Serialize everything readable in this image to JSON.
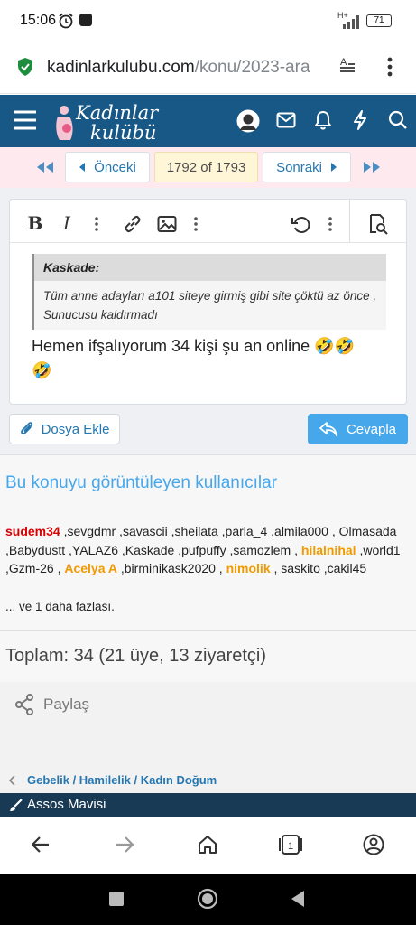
{
  "status": {
    "time": "15:06",
    "network": "H+",
    "battery": "71"
  },
  "browser": {
    "url_domain": "kadinlarkulubu.com",
    "url_path": "/konu/2023-ara"
  },
  "site": {
    "logo_line1": "Kadınlar",
    "logo_line2": "kulübü"
  },
  "pagination": {
    "prev_label": "Önceki",
    "page_info": "1792 of 1793",
    "next_label": "Sonraki"
  },
  "quote": {
    "author": "Kaskade:",
    "text": "Tüm anne adayları a101 siteye girmiş gibi site çöktü az önce , Sunucusu kaldırmadı"
  },
  "reply": {
    "line1": "Hemen ifşalıyorum 34 kişi şu an online 🤣🤣",
    "line2": "🤣"
  },
  "buttons": {
    "attach_label": "Dosya Ekle",
    "reply_label": "Cevapla"
  },
  "viewers": {
    "title": "Bu konuyu görüntüleyen kullanıcılar",
    "u1": "sudem34",
    "t1": " ,sevgdmr ,savascii ,sheilata ,parla_4 ,almila000 , Olmasada ,Babydustt ,YALAZ6 ,Kaskade ,pufpuffy ,samozlem , ",
    "u2": "hilalnihal",
    "t2": " ,world1 ,Gzm-26 , ",
    "u3": "Acelya A",
    "t3": " ,birminikask2020 , ",
    "u4": "nimolik",
    "t4": " , saskito ,cakil45",
    "more": "... ve 1 daha fazlası."
  },
  "totals": {
    "text": "Toplam: 34 (21 üye, 13 ziyaretçi)"
  },
  "share": {
    "label": "Paylaş"
  },
  "breadcrumb": {
    "text": "Gebelik / Hamilelik / Kadın Doğum"
  },
  "theme": {
    "label": "Assos Mavisi"
  }
}
